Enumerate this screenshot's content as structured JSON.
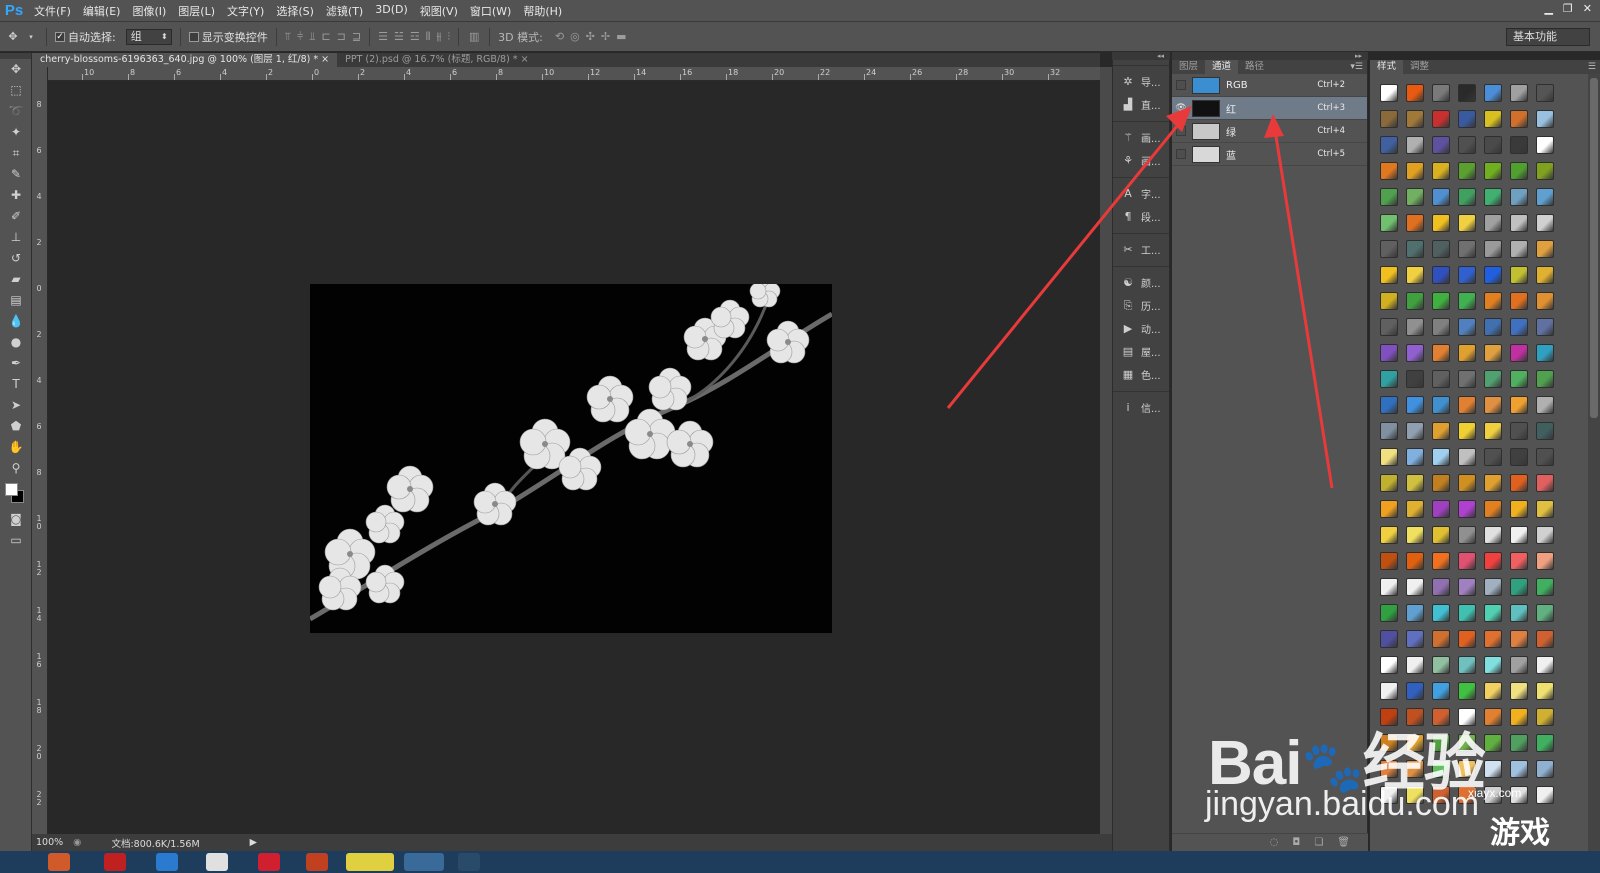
{
  "app": {
    "logo": "Ps"
  },
  "menu": [
    "文件(F)",
    "编辑(E)",
    "图像(I)",
    "图层(L)",
    "文字(Y)",
    "选择(S)",
    "滤镜(T)",
    "3D(D)",
    "视图(V)",
    "窗口(W)",
    "帮助(H)"
  ],
  "options": {
    "auto_select_label": "自动选择:",
    "auto_select_value": "组",
    "show_transform_label": "显示变换控件",
    "mode_3d_label": "3D 模式:",
    "workspace": "基本功能"
  },
  "documents": [
    {
      "title": "cherry-blossoms-6196363_640.jpg @ 100% (图层 1, 红/8) *",
      "close": "×",
      "active": true
    },
    {
      "title": "PPT (2).psd @ 16.7% (标题, RGB/8) *",
      "close": "×",
      "active": false
    }
  ],
  "ruler": {
    "h_labels": [
      "10",
      "8",
      "6",
      "4",
      "2",
      "0",
      "2",
      "4",
      "6",
      "8",
      "10",
      "12",
      "14",
      "16",
      "18",
      "20",
      "22",
      "24",
      "26",
      "28",
      "30",
      "32"
    ],
    "v_labels": [
      "8",
      "6",
      "4",
      "2",
      "0",
      "2",
      "4",
      "6",
      "8",
      "1 0",
      "1 2",
      "1 4",
      "1 6",
      "1 8",
      "2 0",
      "2 2"
    ]
  },
  "status": {
    "zoom": "100%",
    "doc_info": "文档:800.6K/1.56M"
  },
  "panel_strip": {
    "group1": [
      {
        "icon": "navigator-icon",
        "glyph": "✲",
        "label": "导..."
      },
      {
        "icon": "histogram-icon",
        "glyph": "▟",
        "label": "直..."
      }
    ],
    "group2": [
      {
        "icon": "brush-preset-icon",
        "glyph": "⚚",
        "label": "画..."
      },
      {
        "icon": "clone-source-icon",
        "glyph": "⚘",
        "label": "画..."
      }
    ],
    "group3": [
      {
        "icon": "character-icon",
        "glyph": "A",
        "label": "字..."
      },
      {
        "icon": "paragraph-icon",
        "glyph": "¶",
        "label": "段..."
      }
    ],
    "group4": [
      {
        "icon": "tool-presets-icon",
        "glyph": "✂",
        "label": "工..."
      }
    ],
    "group5": [
      {
        "icon": "3d-icon",
        "glyph": "☯",
        "label": "颜..."
      },
      {
        "icon": "history-icon",
        "glyph": "⎘",
        "label": "历..."
      },
      {
        "icon": "actions-icon",
        "glyph": "▶",
        "label": "动..."
      },
      {
        "icon": "layer-comps-icon",
        "glyph": "▤",
        "label": "屋..."
      },
      {
        "icon": "swatches-icon",
        "glyph": "▦",
        "label": "色..."
      }
    ],
    "group6": [
      {
        "icon": "info-icon",
        "glyph": "i",
        "label": "信..."
      }
    ]
  },
  "channels_panel": {
    "tabs": [
      "图层",
      "通道",
      "路径"
    ],
    "active_tab": 1,
    "channels": [
      {
        "name": "RGB",
        "shortcut": "Ctrl+2",
        "visible": false,
        "selected": false,
        "thumb": "#3b8fd0"
      },
      {
        "name": "红",
        "shortcut": "Ctrl+3",
        "visible": true,
        "selected": true,
        "thumb": "#111111"
      },
      {
        "name": "绿",
        "shortcut": "Ctrl+4",
        "visible": false,
        "selected": false,
        "thumb": "#c8c8c8"
      },
      {
        "name": "蓝",
        "shortcut": "Ctrl+5",
        "visible": false,
        "selected": false,
        "thumb": "#d8d8d8"
      }
    ]
  },
  "styles_panel": {
    "tabs": [
      "样式",
      "调整"
    ],
    "active_tab": 0,
    "swatches": [
      "#ffffff",
      "#e85a10",
      "#7a7a7a",
      "#2a2a2a",
      "#4b8ed8",
      "#a0a0a0",
      "#555555",
      "#8a6a3a",
      "#a07838",
      "#c83030",
      "#3a5aa0",
      "#d8c020",
      "#d0702a",
      "#9ac0e0",
      "#4060a0",
      "#b0b0b0",
      "#6050a0",
      "#505050",
      "#4a4a4a",
      "#3a3a3a",
      "#ffffff",
      "#e07820",
      "#e0a020",
      "#d8b020",
      "#5aa030",
      "#70b020",
      "#50a030",
      "#80a020",
      "#50a050",
      "#70b060",
      "#5090d0",
      "#40a060",
      "#40b070",
      "#70a0c0",
      "#60a0d0",
      "#70c070",
      "#e07020",
      "#f0c020",
      "#f0d040",
      "#a0a0a0",
      "#c0c0c0",
      "#d0d0d0",
      "#606060",
      "#507070",
      "#506060",
      "#707070",
      "#9a9a9a",
      "#b0b0b0",
      "#e0a040",
      "#f0c020",
      "#f0d040",
      "#3050c0",
      "#3060d0",
      "#2060e0",
      "#c0c030",
      "#e0b030",
      "#d0b020",
      "#40a040",
      "#40b040",
      "#40b050",
      "#e08020",
      "#e07020",
      "#e09030",
      "#606060",
      "#909090",
      "#808080",
      "#5080c0",
      "#4070b0",
      "#4070c0",
      "#6070a0",
      "#8050c0",
      "#9060d0",
      "#e08030",
      "#e0a030",
      "#e0a040",
      "#c030a0",
      "#30a0c0",
      "#30a0a0",
      "#404040",
      "#606060",
      "#707070",
      "#50a070",
      "#50b060",
      "#50a050",
      "#3070c0",
      "#4090e0",
      "#4090d0",
      "#e08030",
      "#e09040",
      "#f0a030",
      "#b0b0b0",
      "#8090a0",
      "#90a0b0",
      "#e0a030",
      "#f0d030",
      "#f0d040",
      "#505050",
      "#406060",
      "#f0e080",
      "#80b0e0",
      "#a0d0f0",
      "#c0c0c0",
      "#505050",
      "#404040",
      "#505050",
      "#c0b030",
      "#d0c040",
      "#c08020",
      "#d09020",
      "#e0a030",
      "#e06020",
      "#e06060",
      "#f0a020",
      "#e0b030",
      "#a040c0",
      "#b040d0",
      "#e08020",
      "#f0b020",
      "#e0c040",
      "#f0d040",
      "#f0e060",
      "#e0c030",
      "#909090",
      "#e0e0e0",
      "#f0f0f0",
      "#d0d0d0",
      "#c05010",
      "#e06010",
      "#f07020",
      "#e05070",
      "#f04040",
      "#f06060",
      "#f0a080",
      "#f0f0f0",
      "#f0f0f0",
      "#9070b0",
      "#a080c0",
      "#a0b0c0",
      "#30a080",
      "#40b060",
      "#30a040",
      "#60a0d0",
      "#40c0d0",
      "#40c0b0",
      "#50d0b0",
      "#60c0c0",
      "#60b080",
      "#5050a0",
      "#6070c0",
      "#d07030",
      "#e06020",
      "#e07030",
      "#e08040",
      "#d06030",
      "#ffffff",
      "#f0f0f0",
      "#90c0a0",
      "#70c0c0",
      "#80e0e0",
      "#a0a0a0",
      "#f0f0f0",
      "#f0f0f0",
      "#3060c0",
      "#40a0e0",
      "#40c040",
      "#f0d060",
      "#f0e080",
      "#f0e070",
      "#c04010",
      "#c05020",
      "#d06030",
      "#ffffff",
      "#e08030",
      "#f0b020",
      "#d0b030",
      "#d08020",
      "#e0a030",
      "#50a040",
      "#70b050",
      "#60b040",
      "#50a060",
      "#40b060",
      "#e08040",
      "#e09040",
      "#60c060",
      "#f0c060",
      "#d0e0f0",
      "#a0c0e0",
      "#90b0d0",
      "#f0f0f0",
      "#f0e060",
      "#d06030",
      "#e07030",
      "#d0d0d0",
      "#e0e0e0",
      "#f0f0f0"
    ]
  },
  "watermark": {
    "brand": "Bai",
    "brand_cn": "经验",
    "url": "jingyan.baidu.com",
    "site": "xiayx.com",
    "game": "游戏"
  },
  "colors": {
    "accent": "#e83a3a",
    "panel_bg": "#535353",
    "canvas_bg": "#282828",
    "selection": "#707b8a"
  }
}
